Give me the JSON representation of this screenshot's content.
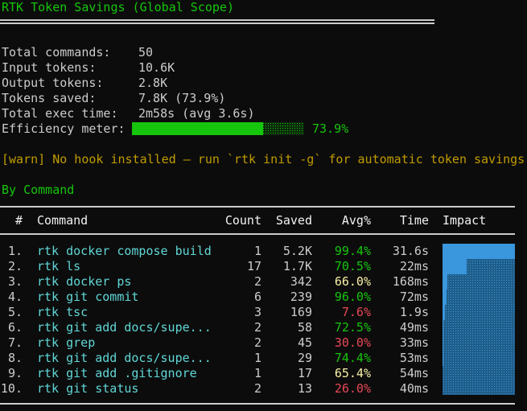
{
  "title": "RTK Token Savings (Global Scope)",
  "summary": {
    "total_commands_label": "Total commands:",
    "total_commands": "50",
    "input_tokens_label": "Input tokens:",
    "input_tokens": "10.6K",
    "output_tokens_label": "Output tokens:",
    "output_tokens": "2.8K",
    "tokens_saved_label": "Tokens saved:",
    "tokens_saved": "7.8K (73.9%)",
    "exec_time_label": "Total exec time:",
    "exec_time": "2m58s (avg 3.6s)",
    "efficiency_label": "Efficiency meter:",
    "efficiency_percent": "73.9%",
    "efficiency_value": 0.739
  },
  "warning": "[warn] No hook installed — run `rtk init -g` for automatic token savings",
  "by_command": {
    "heading": "By Command",
    "columns": {
      "index": "#",
      "command": "Command",
      "count": "Count",
      "saved": "Saved",
      "avg": "Avg%",
      "time": "Time",
      "impact": "Impact"
    },
    "rows": [
      {
        "idx": "1.",
        "cmd": "rtk docker compose build",
        "count": "1",
        "saved": "5.2K",
        "avg": "99.4%",
        "avg_color": "green",
        "time": "31.6s",
        "impact": 1.0
      },
      {
        "idx": "2.",
        "cmd": "rtk ls",
        "count": "17",
        "saved": "1.7K",
        "avg": "70.5%",
        "avg_color": "green",
        "time": "22ms",
        "impact": 0.33
      },
      {
        "idx": "3.",
        "cmd": "rtk docker ps",
        "count": "2",
        "saved": "342",
        "avg": "66.0%",
        "avg_color": "yellow",
        "time": "168ms",
        "impact": 0.07
      },
      {
        "idx": "4.",
        "cmd": "rtk git commit",
        "count": "6",
        "saved": "239",
        "avg": "96.0%",
        "avg_color": "green",
        "time": "72ms",
        "impact": 0.05
      },
      {
        "idx": "5.",
        "cmd": "rtk tsc",
        "count": "3",
        "saved": "169",
        "avg": "7.6%",
        "avg_color": "red",
        "time": "1.9s",
        "impact": 0.03
      },
      {
        "idx": "6.",
        "cmd": "rtk git add docs/supe...",
        "count": "2",
        "saved": "58",
        "avg": "72.5%",
        "avg_color": "green",
        "time": "49ms",
        "impact": 0.01
      },
      {
        "idx": "7.",
        "cmd": "rtk grep",
        "count": "2",
        "saved": "45",
        "avg": "30.0%",
        "avg_color": "red",
        "time": "33ms",
        "impact": 0.01
      },
      {
        "idx": "8.",
        "cmd": "rtk git add docs/supe...",
        "count": "1",
        "saved": "29",
        "avg": "74.4%",
        "avg_color": "green",
        "time": "53ms",
        "impact": 0.01
      },
      {
        "idx": "9.",
        "cmd": "rtk git add .gitignore",
        "count": "1",
        "saved": "17",
        "avg": "65.4%",
        "avg_color": "yellow",
        "time": "54ms",
        "impact": 0.0
      },
      {
        "idx": "10.",
        "cmd": "rtk git status",
        "count": "2",
        "saved": "13",
        "avg": "26.0%",
        "avg_color": "red",
        "time": "40ms",
        "impact": 0.0
      }
    ]
  }
}
